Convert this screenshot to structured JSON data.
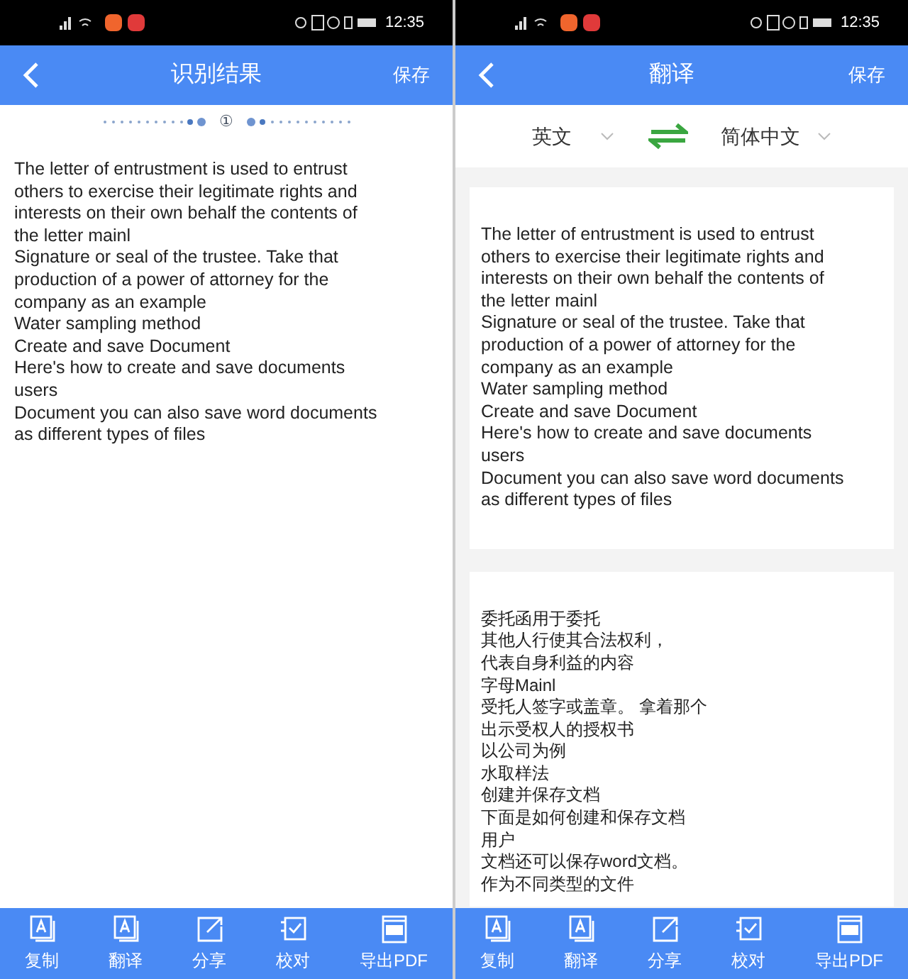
{
  "screens": [
    {
      "kind": "result",
      "status_time": "12:35",
      "title": "识别结果",
      "save": "保存",
      "page_marker": "①",
      "lines": [
        "The letter of entrustment is used to entrust",
        "others to exercise their legitimate rights and",
        "interests on their own behalf the contents of",
        "the letter mainl",
        "Signature or seal of the trustee. Take that",
        "production of a power of attorney for the",
        "company as an example",
        "Water sampling method",
        "Create and save Document",
        "Here's how to create and save documents",
        "users",
        "Document you can also save word documents",
        "as different types of files"
      ],
      "toolbar": [
        {
          "kind": "copy",
          "label": "复制"
        },
        {
          "kind": "translate",
          "label": "翻译"
        },
        {
          "kind": "share",
          "label": "分享"
        },
        {
          "kind": "check",
          "label": "校对"
        },
        {
          "kind": "pdf",
          "label": "导出PDF"
        }
      ]
    },
    {
      "kind": "translate",
      "status_time": "12:35",
      "title": "翻译",
      "save": "保存",
      "source_language": "英文",
      "target_language": "简体中文",
      "lines": [
        "The letter of entrustment is used to entrust",
        "others to exercise their legitimate rights and",
        "interests on their own behalf the contents of",
        "the letter mainl",
        "Signature or seal of the trustee. Take that",
        "production of a power of attorney for the",
        "company as an example",
        "Water sampling method",
        "Create and save Document",
        "Here's how to create and save documents",
        "users",
        "Document you can also save word documents",
        "as different types of files"
      ],
      "translated_lines": [
        "委托函用于委托",
        "其他人行使其合法权利，",
        "代表自身利益的内容",
        "字母Mainl",
        "受托人签字或盖章。 拿着那个",
        "出示受权人的授权书",
        "以公司为例",
        "水取样法",
        "创建并保存文档",
        "下面是如何创建和保存文档",
        "用户",
        "文档还可以保存word文档。",
        "作为不同类型的文件"
      ],
      "toolbar": [
        {
          "kind": "copy",
          "label": "复制"
        },
        {
          "kind": "translate",
          "label": "翻译"
        },
        {
          "kind": "share",
          "label": "分享"
        },
        {
          "kind": "check",
          "label": "校对"
        },
        {
          "kind": "pdf",
          "label": "导出PDF"
        }
      ]
    }
  ]
}
